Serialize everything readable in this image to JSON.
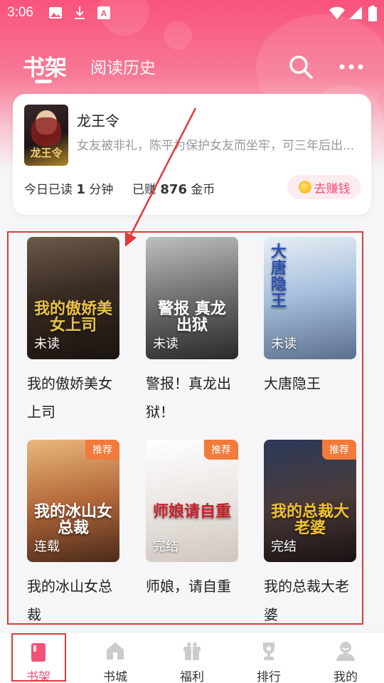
{
  "status_bar": {
    "time": "3:06"
  },
  "top_tabs": {
    "shelf": "书架",
    "history": "阅读历史"
  },
  "recent": {
    "title": "龙王令",
    "cover_text": "龙王令",
    "description": "女友被非礼，陈平为保护女友而坐牢，可三年后出...",
    "today_prefix": "今日已读",
    "today_minutes": "1",
    "today_suffix": "分钟",
    "earned_prefix": "已赚",
    "earned_coins": "876",
    "earned_suffix": "金币",
    "earn_button": "去赚钱"
  },
  "books": [
    {
      "title": "我的傲娇美女上司",
      "status": "未读",
      "tag": "",
      "cover_text": "我的傲娇美女上司",
      "accent": "#e8c24a"
    },
    {
      "title": "警报！真龙出狱！",
      "status": "未读",
      "tag": "",
      "cover_text": "警报 真龙出狱",
      "accent": "#ffffff"
    },
    {
      "title": "大唐隐王",
      "status": "未读",
      "tag": "",
      "cover_text": "大唐隐王",
      "accent": "#2b4fb0"
    },
    {
      "title": "我的冰山女总裁",
      "status": "连载",
      "tag": "推荐",
      "cover_text": "我的冰山女总裁",
      "accent": "#ffffff"
    },
    {
      "title": "师娘，请自重",
      "status": "完结",
      "tag": "推荐",
      "cover_text": "师娘请自重",
      "accent": "#c8232c"
    },
    {
      "title": "我的总裁大老婆",
      "status": "完结",
      "tag": "推荐",
      "cover_text": "我的总裁大老婆",
      "accent": "#f2c230"
    }
  ],
  "bottom_nav": [
    {
      "label": "书架",
      "icon": "bookshelf-icon",
      "active": true
    },
    {
      "label": "书城",
      "icon": "store-icon",
      "active": false
    },
    {
      "label": "福利",
      "icon": "gift-icon",
      "active": false
    },
    {
      "label": "排行",
      "icon": "trophy-icon",
      "active": false
    },
    {
      "label": "我的",
      "icon": "profile-icon",
      "active": false
    }
  ],
  "colors": {
    "brand": "#f45275",
    "tag": "#f27a3a",
    "annotation": "#e03a3a"
  }
}
